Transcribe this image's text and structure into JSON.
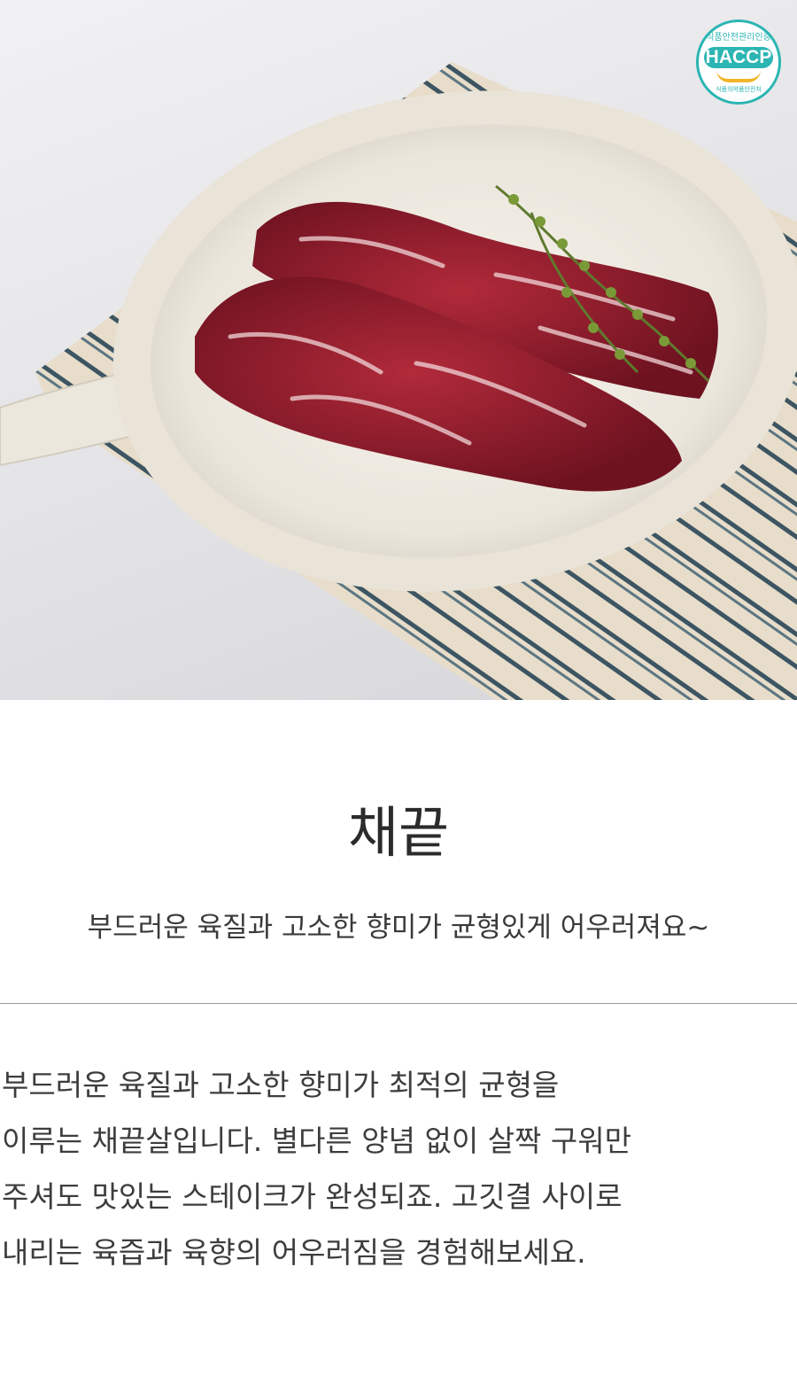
{
  "hero": {
    "image_alt": "채끝 스테이크 고기가 담긴 흰색 팬",
    "badge": {
      "top_text": "식품안전관리인증",
      "main_text": "HACCP",
      "bottom_text": "식품의약품안전처",
      "color": "#2bb5b3"
    }
  },
  "product": {
    "title": "채끝",
    "subtitle": "부드러운 육질과 고소한 향미가 균형있게 어우러져요~"
  },
  "description": {
    "lines": [
      "부드러운 육질과 고소한 향미가 최적의 균형을",
      "이루는 채끝살입니다. 별다른 양념 없이 살짝 구워만",
      "주셔도 맛있는 스테이크가 완성되죠. 고깃결 사이로",
      "내리는 육즙과 육향의 어우러짐을 경험해보세요."
    ]
  }
}
